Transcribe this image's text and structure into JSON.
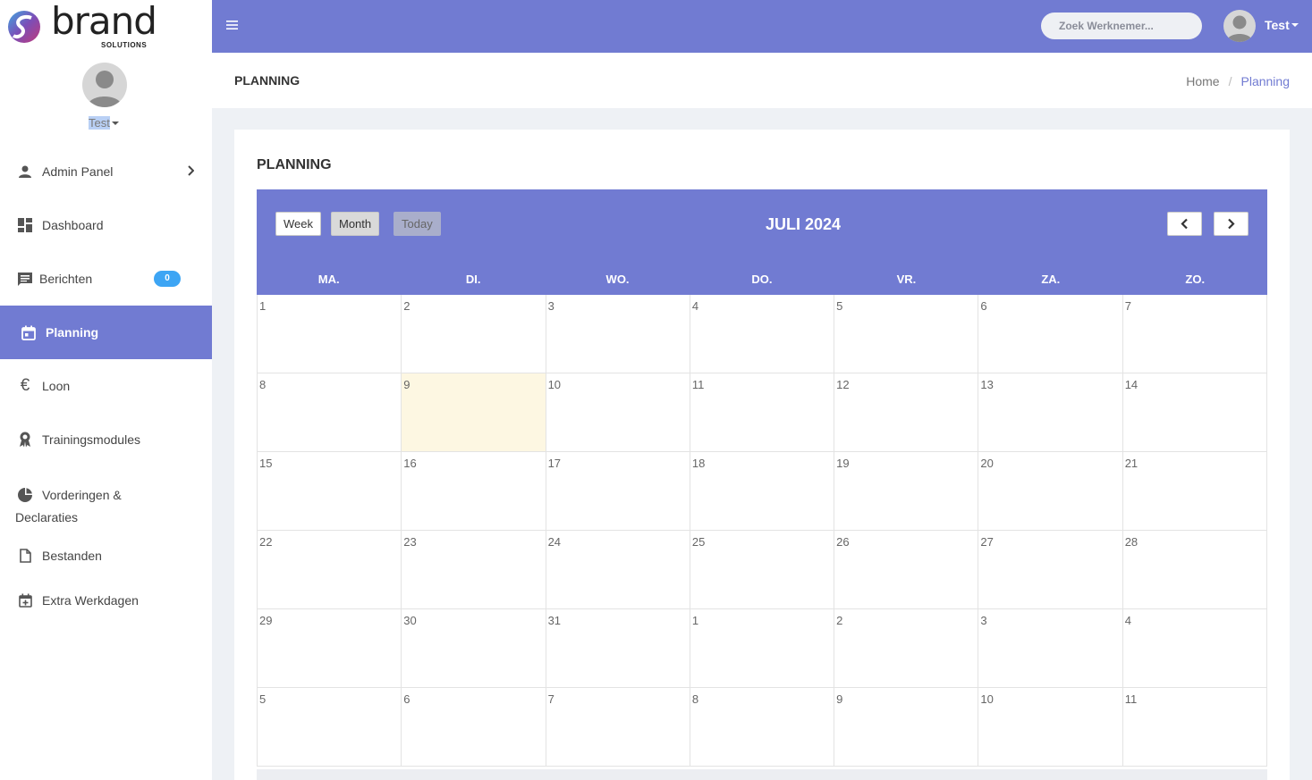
{
  "brand": {
    "name": "brand",
    "sub": "SOLUTIONS"
  },
  "profile": {
    "name": "Test"
  },
  "sidebar": {
    "items": [
      {
        "label": "Admin Panel",
        "icon": "person-icon"
      },
      {
        "label": "Dashboard",
        "icon": "dashboard-icon"
      },
      {
        "label": "Berichten",
        "icon": "message-icon",
        "badge": "0"
      },
      {
        "label": "Planning",
        "icon": "calendar-icon",
        "active": true
      },
      {
        "label": "Loon",
        "icon": "euro-icon"
      },
      {
        "label": "Trainingsmodules",
        "icon": "award-icon"
      },
      {
        "label_line1": "Vorderingen &",
        "label_line2": "Declaraties",
        "icon": "pie-chart-icon"
      },
      {
        "label": "Bestanden",
        "icon": "file-icon"
      },
      {
        "label": "Extra Werkdagen",
        "icon": "calendar-plus-icon"
      }
    ]
  },
  "topbar": {
    "search_placeholder": "Zoek Werknemer...",
    "user": "Test"
  },
  "header": {
    "title": "PLANNING",
    "breadcrumb": {
      "home": "Home",
      "separator": "/",
      "current": "Planning"
    }
  },
  "card": {
    "title": "PLANNING"
  },
  "calendar": {
    "buttons": {
      "week": "Week",
      "month": "Month",
      "today": "Today"
    },
    "title": "JULI 2024",
    "weekdays": [
      "MA.",
      "DI.",
      "WO.",
      "DO.",
      "VR.",
      "ZA.",
      "ZO."
    ],
    "days": [
      "1",
      "2",
      "3",
      "4",
      "5",
      "6",
      "7",
      "8",
      "9",
      "10",
      "11",
      "12",
      "13",
      "14",
      "15",
      "16",
      "17",
      "18",
      "19",
      "20",
      "21",
      "22",
      "23",
      "24",
      "25",
      "26",
      "27",
      "28",
      "29",
      "30",
      "31",
      "1",
      "2",
      "3",
      "4",
      "5",
      "6",
      "7",
      "8",
      "9",
      "10",
      "11"
    ],
    "today_index": 8
  },
  "colors": {
    "accent": "#717bd2",
    "badge": "#3da5f4",
    "today": "#fdf7e2"
  }
}
